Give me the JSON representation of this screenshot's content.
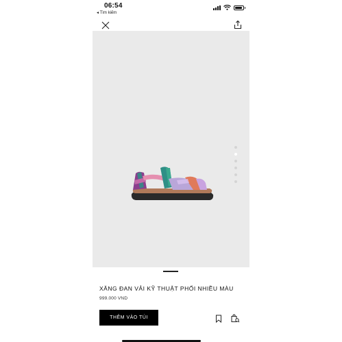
{
  "status_bar": {
    "time": "06:54",
    "back_label": "◂ Tìm kiếm",
    "signal_bars": 4,
    "battery_level": 0.9
  },
  "header": {
    "close_icon": "close-icon",
    "share_icon": "share-icon"
  },
  "gallery": {
    "image_count": 6,
    "active_index": 1,
    "colors": {
      "background": "#eaeaea",
      "strap_purple": "#8b3f8e",
      "strap_teal": "#2f8f86",
      "strap_pink": "#e58fb0",
      "strap_lilac": "#b9a6d9",
      "footbed": "#b07a5a",
      "sole": "#2a2a2a"
    }
  },
  "product": {
    "name": "XĂNG ĐAN VẢI KỸ THUẬT PHỐI NHIỀU MÀU",
    "price": "999.000 VND"
  },
  "actions": {
    "add_to_bag_label": "THÊM VÀO TÚI",
    "bookmark_icon": "bookmark-icon",
    "similar_icon": "similar-products-icon"
  }
}
